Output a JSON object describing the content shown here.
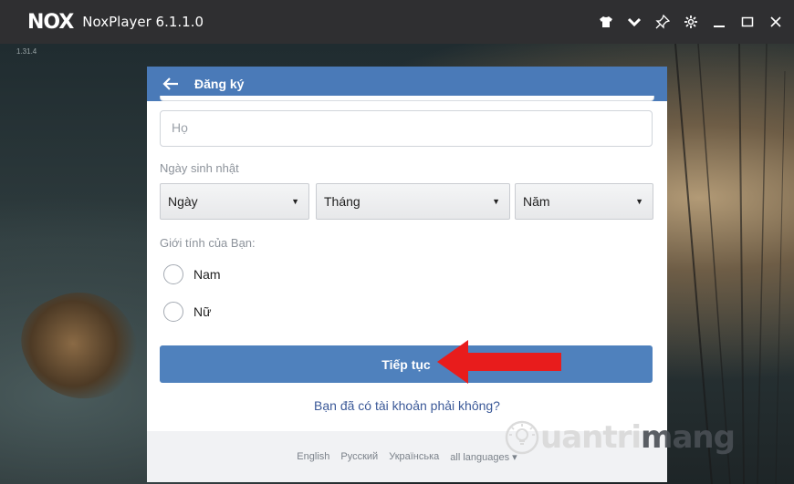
{
  "window": {
    "logo_text": "NOX",
    "title": "NoxPlayer 6.1.1.0",
    "controls": [
      "shirt-icon",
      "chevron-down-icon",
      "pin-icon",
      "gear-icon",
      "minimize-icon",
      "maximize-icon",
      "close-icon"
    ]
  },
  "emulator": {
    "version_tag": "1.31.4"
  },
  "dialog": {
    "header_title": "Đăng ký",
    "last_name_placeholder": "Họ",
    "dob_label": "Ngày sinh nhật",
    "day_select": "Ngày",
    "month_select": "Tháng",
    "year_select": "Năm",
    "gender_label": "Giới tính của Bạn:",
    "gender_options": [
      "Nam",
      "Nữ"
    ],
    "continue_button": "Tiếp tục",
    "have_account_link": "Bạn đã có tài khoản phải không?",
    "footer_languages": [
      "English",
      "Русский",
      "Українська",
      "all languages ▾"
    ]
  },
  "watermark": {
    "text_part1": "uantri",
    "text_part2": "mang"
  },
  "colors": {
    "titlebar": "#2f2f31",
    "header_blue": "#4a7ab8",
    "button_blue": "#4f81bd",
    "link_blue": "#3b5998",
    "arrow_red": "#e81c1c"
  }
}
